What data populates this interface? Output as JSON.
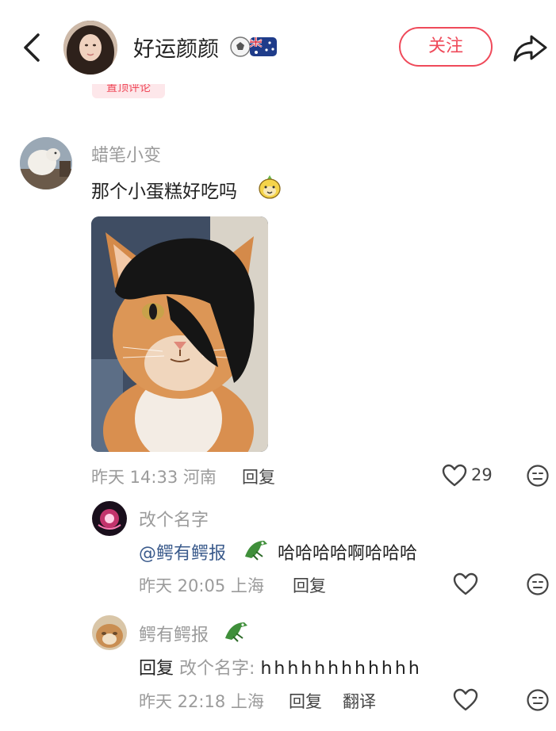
{
  "header": {
    "username": "好运颜颜",
    "follow_label": "关注"
  },
  "pinned_tag": "置顶评论",
  "comment": {
    "author": "蜡笔小变",
    "text": "那个小蛋糕好吃吗",
    "meta": "昨天 14:33 河南",
    "reply_label": "回复",
    "like_count": "29"
  },
  "replies": [
    {
      "author": "改个名字",
      "mention": "@鳄有鳄报",
      "text": "哈哈哈哈啊哈哈哈",
      "meta": "昨天 20:05 上海",
      "reply_label": "回复"
    },
    {
      "author": "鳄有鳄报",
      "reply_prefix": "回复",
      "reply_target": "改个名字:",
      "text": "hhhhhhhhhhhh",
      "meta": "昨天 22:18 上海",
      "reply_label": "回复",
      "translate_label": "翻译"
    }
  ],
  "colors": {
    "accent": "#ef4a5a",
    "muted": "#9b9b9b",
    "mention": "#3b5b8c"
  },
  "icons": [
    "back-icon",
    "soccer-ball-icon",
    "australia-flag-icon",
    "share-icon",
    "emoji-sticker-icon",
    "heart-icon",
    "comment-emoji-icon",
    "crocodile-icon"
  ]
}
